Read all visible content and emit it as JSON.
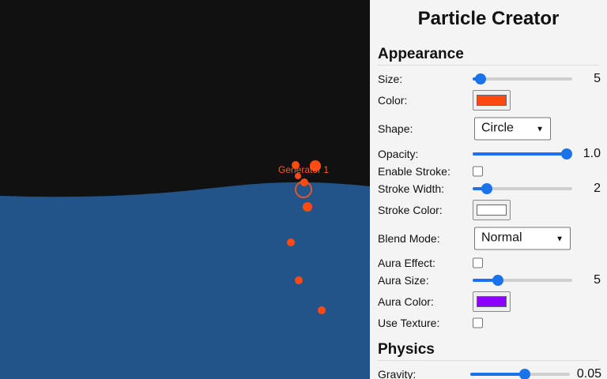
{
  "canvas": {
    "colors": {
      "sky": "#111111",
      "water": "#22548a",
      "particle": "#ff4a14",
      "generator_ring": "#e0582a"
    },
    "generator_label": "Generator 1"
  },
  "panel": {
    "title": "Particle Creator",
    "appearance": {
      "heading": "Appearance",
      "size": {
        "label": "Size:",
        "value": "5",
        "fraction": 0.03
      },
      "color": {
        "label": "Color:",
        "value": "#ff4a14"
      },
      "shape": {
        "label": "Shape:",
        "value": "Circle"
      },
      "opacity": {
        "label": "Opacity:",
        "value": "1.0",
        "fraction": 1.0
      },
      "enable_stroke": {
        "label": "Enable Stroke:",
        "checked": false
      },
      "stroke_width": {
        "label": "Stroke Width:",
        "value": "2",
        "fraction": 0.1
      },
      "stroke_color": {
        "label": "Stroke Color:",
        "value": "#ffffff"
      },
      "blend_mode": {
        "label": "Blend Mode:",
        "value": "Normal"
      },
      "aura_effect": {
        "label": "Aura Effect:",
        "checked": false
      },
      "aura_size": {
        "label": "Aura Size:",
        "value": "5",
        "fraction": 0.22
      },
      "aura_color": {
        "label": "Aura Color:",
        "value": "#8b00ff"
      },
      "use_texture": {
        "label": "Use Texture:",
        "checked": false
      }
    },
    "physics": {
      "heading": "Physics",
      "gravity": {
        "label": "Gravity:",
        "value": "0.05",
        "fraction": 0.55
      }
    }
  }
}
